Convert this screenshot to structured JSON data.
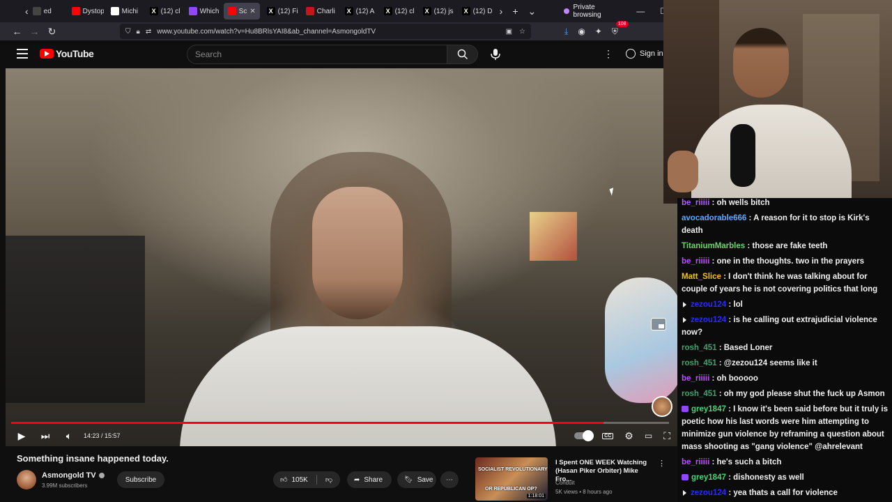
{
  "browser": {
    "tabs": [
      {
        "label": "ed",
        "color": "#444"
      },
      {
        "label": "Dystop",
        "color": "#ff0000"
      },
      {
        "label": "Michi",
        "color": "#fff",
        "glyph": "AP"
      },
      {
        "label": "(12) cl",
        "color": "#000",
        "glyph": "X"
      },
      {
        "label": "Which",
        "color": "#9146ff"
      },
      {
        "label": "Sc",
        "color": "#ff0000",
        "active": true
      },
      {
        "label": "(12) Fi",
        "color": "#000",
        "glyph": "X"
      },
      {
        "label": "Charli",
        "color": "#c4161c"
      },
      {
        "label": "(12) A",
        "color": "#000",
        "glyph": "X"
      },
      {
        "label": "(12) cl",
        "color": "#000",
        "glyph": "X"
      },
      {
        "label": "(12) js",
        "color": "#000",
        "glyph": "X"
      },
      {
        "label": "(12) D",
        "color": "#000",
        "glyph": "X"
      }
    ],
    "private_label": "Private browsing",
    "url": "www.youtube.com/watch?v=Hu8BRlsYAI8&ab_channel=AsmongoldTV",
    "notification_count": "108"
  },
  "youtube": {
    "logo_text": "YouTube",
    "search_placeholder": "Search",
    "signin_label": "Sign in"
  },
  "player": {
    "time": "14:23 / 15:57",
    "progress": 0.9
  },
  "video": {
    "title": "Something insane happened today.",
    "channel": "Asmongold TV",
    "subscribers": "3.99M subscribers",
    "subscribe_label": "Subscribe",
    "likes": "105K",
    "share_label": "Share",
    "save_label": "Save"
  },
  "recommended": {
    "title": "I Spent ONE WEEK Watching (Hasan Piker Orbiter) Mike Fro...",
    "channel": "Conduit",
    "meta": "5K views • 8 hours ago",
    "duration": "1:18:01",
    "thumb_text_1": "SOCIALIST REVOLUTIONARY",
    "thumb_text_2": "OR REPUBLICAN OP?"
  },
  "chat": [
    {
      "user": "be_riiiii",
      "text": "oh wells bitch",
      "color": "#b15fff",
      "icon": ""
    },
    {
      "user": "avocadorable666",
      "text": "A reason for it to stop is Kirk's death",
      "color": "#5fa8ff",
      "icon": ""
    },
    {
      "user": "TitaniumMarbles",
      "text": "those are fake teeth",
      "color": "#6bd66b",
      "icon": ""
    },
    {
      "user": "be_riiiii",
      "text": "one in the thoughts. two in the prayers",
      "color": "#c04dff",
      "icon": ""
    },
    {
      "user": "Matt_Slice",
      "text": "I don't think he was talking about for couple of years he is not covering politics that long",
      "color": "#f5c400",
      "icon": ""
    },
    {
      "user": "zezou124",
      "text": "lol",
      "color": "#2b2bff",
      "icon": "speaker"
    },
    {
      "user": "zezou124",
      "text": "is he calling out extrajudicial violence now?",
      "color": "#2b2bff",
      "icon": "speaker"
    },
    {
      "user": "rosh_451",
      "text": "Based Loner",
      "color": "#3ca36e",
      "icon": ""
    },
    {
      "user": "rosh_451",
      "text": "@zezou124 seems like it",
      "color": "#3ca36e",
      "icon": ""
    },
    {
      "user": "be_riiiii",
      "text": "oh booooo",
      "color": "#c04dff",
      "icon": ""
    },
    {
      "user": "rosh_451",
      "text": "oh my god please shut the fuck up Asmon",
      "color": "#3ca36e",
      "icon": ""
    },
    {
      "user": "grey1847",
      "text": "I know it's been said before but it truly is poetic how his last words were him attempting to minimize gun violence by reframing a question about mass shooting as \"gang violence\" @ahrelevant",
      "color": "#4cd47a",
      "icon": "twitch"
    },
    {
      "user": "be_riiiii",
      "text": "he's such a bitch",
      "color": "#c04dff",
      "icon": ""
    },
    {
      "user": "grey1847",
      "text": "dishonesty as well",
      "color": "#4cd47a",
      "icon": "twitch"
    },
    {
      "user": "zezou124",
      "text": "yea thats a call for violence",
      "color": "#2b2bff",
      "icon": "speaker"
    }
  ]
}
